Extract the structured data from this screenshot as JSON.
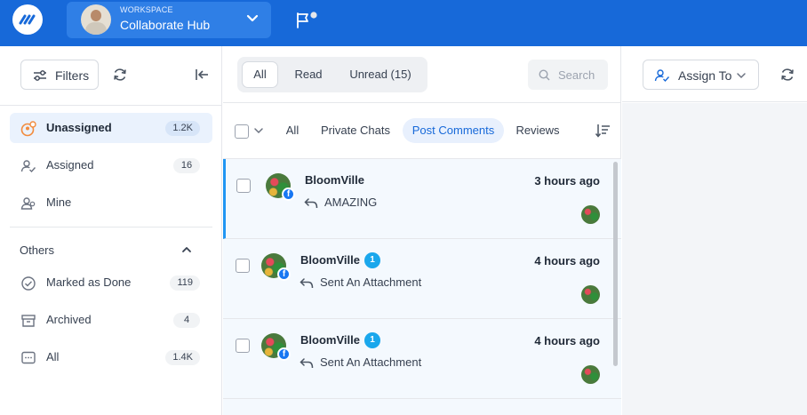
{
  "topbar": {
    "logo_icon": "app-logo-icon",
    "workspace_label": "WORKSPACE",
    "workspace_name": "Collaborate Hub",
    "accent_color": "#1769d9"
  },
  "left_panel": {
    "filters_label": "Filters",
    "nav": [
      {
        "label": "Unassigned",
        "count": "1.2K",
        "icon": "unassigned-icon",
        "active": true
      },
      {
        "label": "Assigned",
        "count": "16",
        "icon": "assigned-icon"
      },
      {
        "label": "Mine",
        "icon": "mine-icon"
      }
    ],
    "others_label": "Others",
    "others": [
      {
        "label": "Marked as Done",
        "count": "119",
        "icon": "done-icon"
      },
      {
        "label": "Archived",
        "count": "4",
        "icon": "archive-icon"
      },
      {
        "label": "All",
        "count": "1.4K",
        "icon": "chat-icon"
      }
    ]
  },
  "middle_panel": {
    "read_tabs": [
      {
        "label": "All",
        "active": true
      },
      {
        "label": "Read"
      },
      {
        "label": "Unread (15)"
      }
    ],
    "search_placeholder": "Search",
    "filter_tabs": [
      {
        "label": "All"
      },
      {
        "label": "Private Chats"
      },
      {
        "label": "Post Comments",
        "active": true
      },
      {
        "label": "Reviews"
      }
    ],
    "conversations": [
      {
        "name": "BloomVille",
        "time": "3 hours ago",
        "message": "AMAZING",
        "selected": true
      },
      {
        "name": "BloomVille",
        "badge": "1",
        "time": "4 hours ago",
        "message": "Sent An Attachment"
      },
      {
        "name": "BloomVille",
        "badge": "1",
        "time": "4 hours ago",
        "message": "Sent An Attachment"
      }
    ]
  },
  "right_panel": {
    "assign_label": "Assign To"
  }
}
